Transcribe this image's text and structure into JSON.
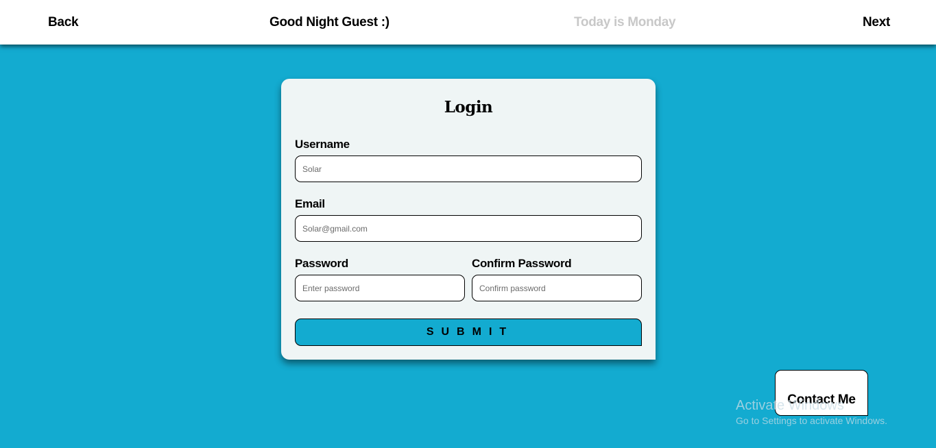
{
  "header": {
    "back_label": "Back",
    "greeting": "Good Night Guest :)",
    "day_text": "Today is Monday",
    "next_label": "Next"
  },
  "login_form": {
    "title": "Login",
    "username": {
      "label": "Username",
      "placeholder": "Solar",
      "value": ""
    },
    "email": {
      "label": "Email",
      "placeholder": "Solar@gmail.com",
      "value": ""
    },
    "password": {
      "label": "Password",
      "placeholder": "Enter password",
      "value": ""
    },
    "confirm_password": {
      "label": "Confirm Password",
      "placeholder": "Confirm password",
      "value": ""
    },
    "submit_label": "SUBMIT"
  },
  "contact_button": {
    "label": "Contact Me"
  },
  "windows_watermark": {
    "title": "Activate Windows",
    "subtitle": "Go to Settings to activate Windows."
  },
  "colors": {
    "background": "#13abd0",
    "header_bg": "#ffffff",
    "card_bg": "#eff5f5",
    "submit_bg": "#13abd0",
    "muted_text": "#c8c8c8"
  }
}
